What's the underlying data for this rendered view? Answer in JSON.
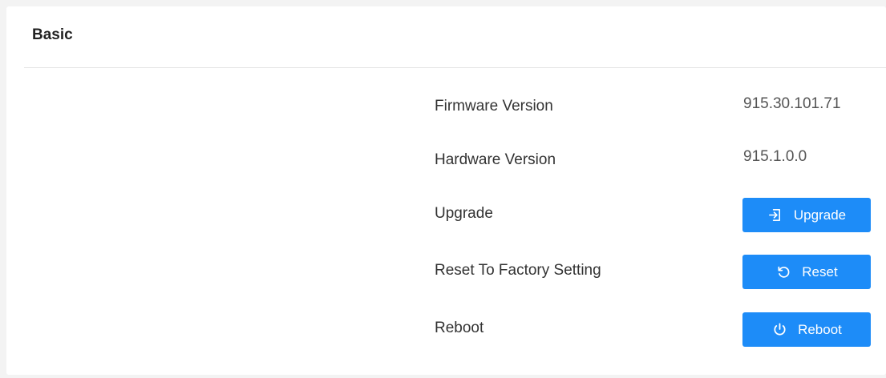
{
  "panel": {
    "title": "Basic"
  },
  "rows": {
    "firmware": {
      "label": "Firmware Version",
      "value": "915.30.101.71"
    },
    "hardware": {
      "label": "Hardware Version",
      "value": "915.1.0.0"
    },
    "upgrade": {
      "label": "Upgrade",
      "button": "Upgrade",
      "icon": "upgrade-import-icon"
    },
    "reset": {
      "label": "Reset To Factory Setting",
      "button": "Reset",
      "icon": "reset-rotate-icon"
    },
    "reboot": {
      "label": "Reboot",
      "button": "Reboot",
      "icon": "power-icon"
    }
  },
  "colors": {
    "accent": "#1d8cf8",
    "background": "#f3f3f3",
    "panel": "#ffffff"
  }
}
